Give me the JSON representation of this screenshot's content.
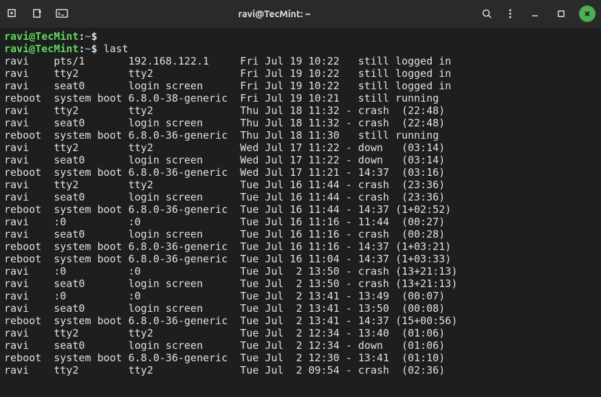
{
  "titlebar": {
    "title": "ravi@TecMint: ~"
  },
  "prompt": {
    "user_host": "ravi@TecMint",
    "sep": ":",
    "path": "~",
    "dollar": "$"
  },
  "command": "last",
  "rows": [
    {
      "user": "ravi    ",
      "tty": "pts/1       ",
      "from": "192.168.122.1     ",
      "when": "Fri Jul 19 10:22",
      "rest": "   still logged in"
    },
    {
      "user": "ravi    ",
      "tty": "tty2        ",
      "from": "tty2              ",
      "when": "Fri Jul 19 10:22",
      "rest": "   still logged in"
    },
    {
      "user": "ravi    ",
      "tty": "seat0       ",
      "from": "login screen      ",
      "when": "Fri Jul 19 10:22",
      "rest": "   still logged in"
    },
    {
      "user": "reboot  ",
      "tty": "system boot ",
      "from": "6.8.0-38-generic  ",
      "when": "Fri Jul 19 10:21",
      "rest": "   still running"
    },
    {
      "user": "ravi    ",
      "tty": "tty2        ",
      "from": "tty2              ",
      "when": "Thu Jul 18 11:32",
      "rest": " - crash  (22:48)"
    },
    {
      "user": "ravi    ",
      "tty": "seat0       ",
      "from": "login screen      ",
      "when": "Thu Jul 18 11:32",
      "rest": " - crash  (22:48)"
    },
    {
      "user": "reboot  ",
      "tty": "system boot ",
      "from": "6.8.0-36-generic  ",
      "when": "Thu Jul 18 11:30",
      "rest": "   still running"
    },
    {
      "user": "ravi    ",
      "tty": "tty2        ",
      "from": "tty2              ",
      "when": "Wed Jul 17 11:22",
      "rest": " - down   (03:14)"
    },
    {
      "user": "ravi    ",
      "tty": "seat0       ",
      "from": "login screen      ",
      "when": "Wed Jul 17 11:22",
      "rest": " - down   (03:14)"
    },
    {
      "user": "reboot  ",
      "tty": "system boot ",
      "from": "6.8.0-36-generic  ",
      "when": "Wed Jul 17 11:21",
      "rest": " - 14:37  (03:16)"
    },
    {
      "user": "ravi    ",
      "tty": "tty2        ",
      "from": "tty2              ",
      "when": "Tue Jul 16 11:44",
      "rest": " - crash  (23:36)"
    },
    {
      "user": "ravi    ",
      "tty": "seat0       ",
      "from": "login screen      ",
      "when": "Tue Jul 16 11:44",
      "rest": " - crash  (23:36)"
    },
    {
      "user": "reboot  ",
      "tty": "system boot ",
      "from": "6.8.0-36-generic  ",
      "when": "Tue Jul 16 11:44",
      "rest": " - 14:37 (1+02:52)"
    },
    {
      "user": "ravi    ",
      "tty": ":0          ",
      "from": ":0                ",
      "when": "Tue Jul 16 11:16",
      "rest": " - 11:44  (00:27)"
    },
    {
      "user": "ravi    ",
      "tty": "seat0       ",
      "from": "login screen      ",
      "when": "Tue Jul 16 11:16",
      "rest": " - crash  (00:28)"
    },
    {
      "user": "reboot  ",
      "tty": "system boot ",
      "from": "6.8.0-36-generic  ",
      "when": "Tue Jul 16 11:16",
      "rest": " - 14:37 (1+03:21)"
    },
    {
      "user": "reboot  ",
      "tty": "system boot ",
      "from": "6.8.0-36-generic  ",
      "when": "Tue Jul 16 11:04",
      "rest": " - 14:37 (1+03:33)"
    },
    {
      "user": "ravi    ",
      "tty": ":0          ",
      "from": ":0                ",
      "when": "Tue Jul  2 13:50",
      "rest": " - crash (13+21:13)"
    },
    {
      "user": "ravi    ",
      "tty": "seat0       ",
      "from": "login screen      ",
      "when": "Tue Jul  2 13:50",
      "rest": " - crash (13+21:13)"
    },
    {
      "user": "ravi    ",
      "tty": ":0          ",
      "from": ":0                ",
      "when": "Tue Jul  2 13:41",
      "rest": " - 13:49  (00:07)"
    },
    {
      "user": "ravi    ",
      "tty": "seat0       ",
      "from": "login screen      ",
      "when": "Tue Jul  2 13:41",
      "rest": " - 13:50  (00:08)"
    },
    {
      "user": "reboot  ",
      "tty": "system boot ",
      "from": "6.8.0-36-generic  ",
      "when": "Tue Jul  2 13:41",
      "rest": " - 14:37 (15+00:56)"
    },
    {
      "user": "ravi    ",
      "tty": "tty2        ",
      "from": "tty2              ",
      "when": "Tue Jul  2 12:34",
      "rest": " - 13:40  (01:06)"
    },
    {
      "user": "ravi    ",
      "tty": "seat0       ",
      "from": "login screen      ",
      "when": "Tue Jul  2 12:34",
      "rest": " - down   (01:06)"
    },
    {
      "user": "reboot  ",
      "tty": "system boot ",
      "from": "6.8.0-36-generic  ",
      "when": "Tue Jul  2 12:30",
      "rest": " - 13:41  (01:10)"
    },
    {
      "user": "ravi    ",
      "tty": "tty2        ",
      "from": "tty2              ",
      "when": "Tue Jul  2 09:54",
      "rest": " - crash  (02:36)"
    }
  ]
}
